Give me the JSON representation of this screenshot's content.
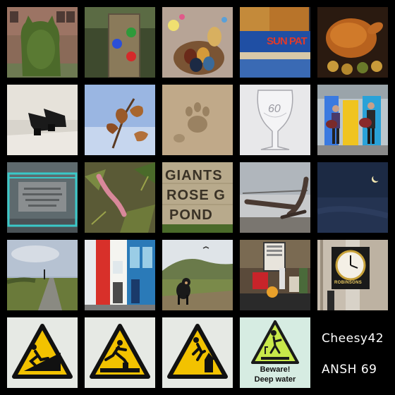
{
  "tiles": [
    {
      "name": "topiary-cat"
    },
    {
      "name": "waymarker-post"
    },
    {
      "name": "easter-eggs-basket"
    },
    {
      "name": "jam-jars"
    },
    {
      "name": "roast-chicken"
    },
    {
      "name": "platform-shoes"
    },
    {
      "name": "oak-leaves-sky"
    },
    {
      "name": "animal-footprint"
    },
    {
      "name": "wine-glass-60"
    },
    {
      "name": "drummers"
    },
    {
      "name": "commemorative-plaque"
    },
    {
      "name": "earthworm"
    },
    {
      "name": "giants-rose-garden-sign"
    },
    {
      "name": "anchor-sculpture"
    },
    {
      "name": "moon-night-sky"
    },
    {
      "name": "country-path"
    },
    {
      "name": "colourful-street"
    },
    {
      "name": "dog-hills"
    },
    {
      "name": "cafe-counter"
    },
    {
      "name": "street-clock"
    },
    {
      "name": "slippery-slope-sign"
    },
    {
      "name": "trip-hazard-sign"
    },
    {
      "name": "cliff-fall-sign"
    },
    {
      "name": "deep-water-sign"
    }
  ],
  "signs": {
    "jam_label": "SUN PAT",
    "glass_number": "60",
    "giants_line1": "GIANTS",
    "giants_line2": "ROSE G",
    "giants_line3": "POND",
    "clock_shop": "ROBINSONS",
    "deep_water_line1": "Beware!",
    "deep_water_line2": "Deep water"
  },
  "caption": {
    "username": "Cheesy42",
    "tag": "ANSH 69"
  },
  "colors": {
    "background": "#000000",
    "caption_text": "#ffffff",
    "warning_yellow": "#f2c200",
    "warning_green": "#c8e84a"
  }
}
